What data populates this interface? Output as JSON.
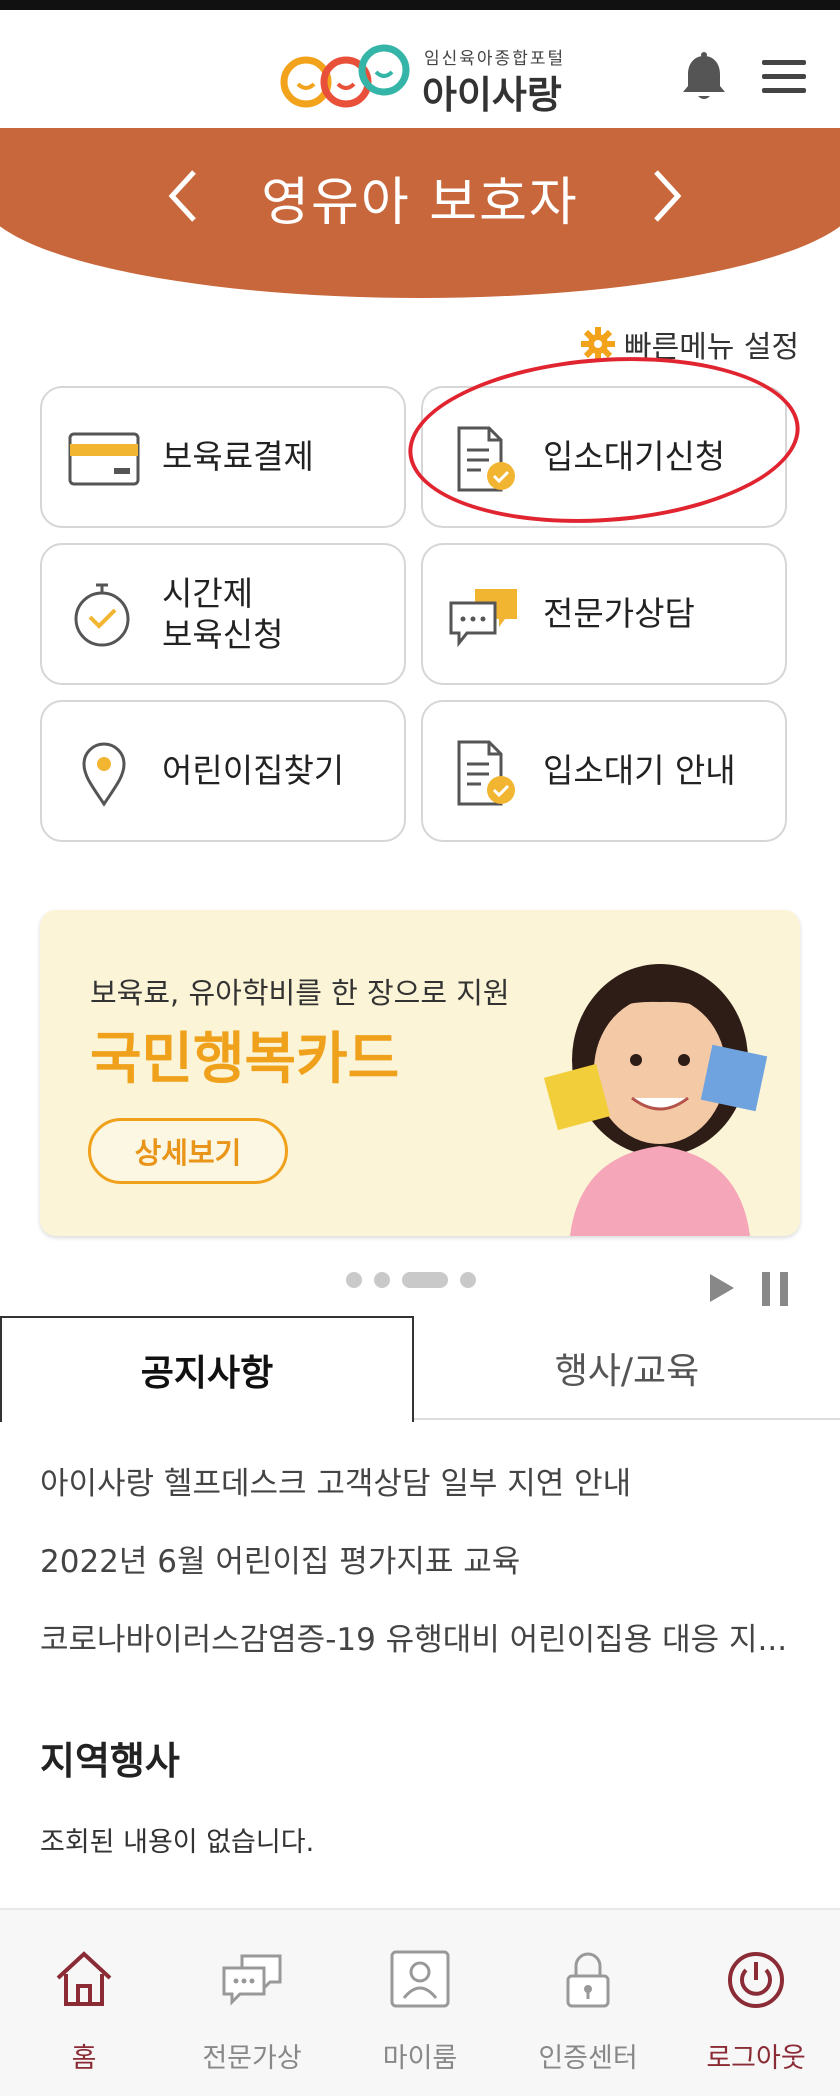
{
  "header": {
    "logo_sub": "임신육아종합포털",
    "logo_main": "아이사랑",
    "bell_icon": "bell-icon",
    "menu_icon": "hamburger-menu-icon"
  },
  "banner": {
    "title": "영유아 보호자",
    "color": "#c9673c"
  },
  "quick_menu": {
    "setting_label": "빠른메뉴 설정",
    "tiles": [
      {
        "label": "보육료결제",
        "icon": "card-icon"
      },
      {
        "label": "입소대기신청",
        "icon": "document-check-icon"
      },
      {
        "label": "시간제\n보육신청",
        "icon": "clock-icon"
      },
      {
        "label": "전문가상담",
        "icon": "chat-bubbles-icon"
      },
      {
        "label": "어린이집찾기",
        "icon": "location-pin-icon"
      },
      {
        "label": "입소대기 안내",
        "icon": "document-check-icon"
      }
    ]
  },
  "promo": {
    "subtitle": "보육료, 유아학비를 한 장으로 지원",
    "title": "국민행복카드",
    "button": "상세보기",
    "accent": "#f0a11c"
  },
  "carousel": {
    "active_index": 2,
    "count": 4
  },
  "tabs": {
    "active": "공지사항",
    "inactive": "행사/교육"
  },
  "notices": [
    "아이사랑 헬프데스크 고객상담 일부 지연 안내",
    "2022년 6월 어린이집 평가지표 교육",
    "코로나바이러스감염증-19 유행대비 어린이집용 대응 지..."
  ],
  "region": {
    "title": "지역행사",
    "empty_text": "조회된 내용이 없습니다."
  },
  "bottom_nav": [
    {
      "label": "홈",
      "icon": "home-icon"
    },
    {
      "label": "전문가상",
      "icon": "chat-icon"
    },
    {
      "label": "마이룸",
      "icon": "person-icon"
    },
    {
      "label": "인증센터",
      "icon": "lock-icon"
    },
    {
      "label": "로그아웃",
      "icon": "power-icon"
    }
  ]
}
